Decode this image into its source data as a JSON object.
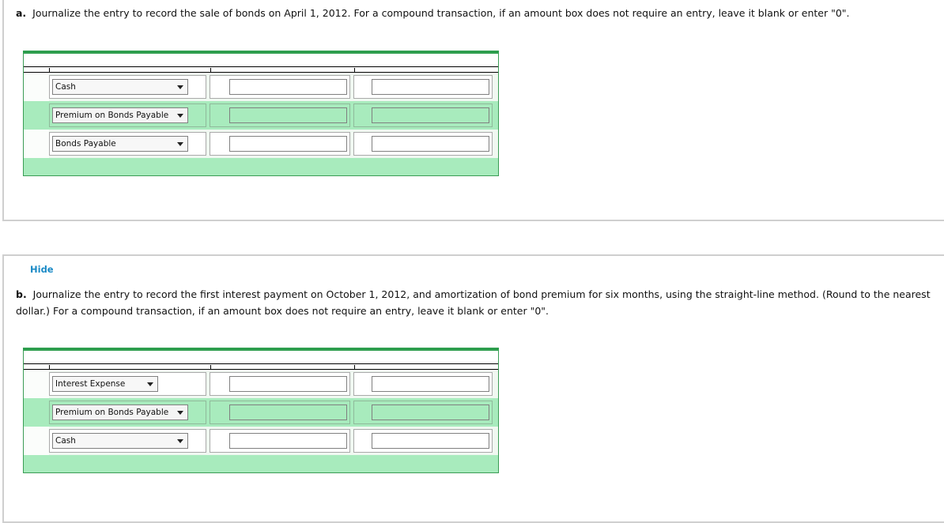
{
  "part_a": {
    "label": "a.",
    "instruction": "Journalize the entry to record the sale of bonds on April 1, 2012. For a compound transaction, if an amount box does not require an entry, leave it blank or enter \"0\".",
    "rows": [
      {
        "account": "Cash",
        "debit": "",
        "credit": ""
      },
      {
        "account": "Premium on Bonds Payable",
        "debit": "",
        "credit": ""
      },
      {
        "account": "Bonds Payable",
        "debit": "",
        "credit": ""
      }
    ]
  },
  "part_b": {
    "hide_label": "Hide",
    "label": "b.",
    "instruction": "Journalize the entry to record the first interest payment on October 1, 2012, and amortization of bond premium for six months, using the straight-line method. (Round to the nearest dollar.) For a compound transaction, if an amount box does not require an entry, leave it blank or enter \"0\".",
    "rows": [
      {
        "account": "Interest Expense",
        "debit": "",
        "credit": ""
      },
      {
        "account": "Premium on Bonds Payable",
        "debit": "",
        "credit": ""
      },
      {
        "account": "Cash",
        "debit": "",
        "credit": ""
      }
    ]
  },
  "colors": {
    "accent_green": "#2e9e4e",
    "row_green": "#a8ebbd",
    "link_blue": "#1a8ac6"
  }
}
